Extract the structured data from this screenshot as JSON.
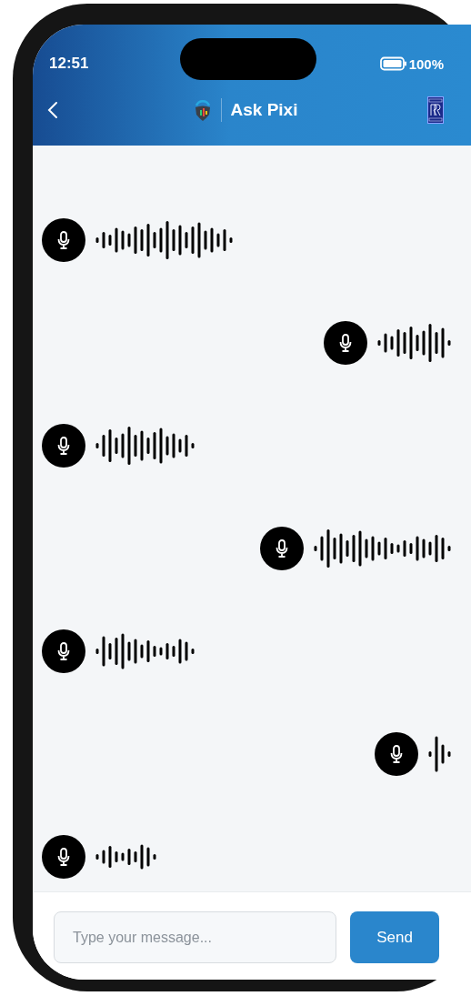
{
  "status_bar": {
    "time": "12:51",
    "battery": "100%"
  },
  "header": {
    "title": "Ask Pixi"
  },
  "messages": [
    {
      "kind": "incoming"
    },
    {
      "kind": "outgoing"
    },
    {
      "kind": "incoming"
    },
    {
      "kind": "outgoing"
    },
    {
      "kind": "incoming"
    },
    {
      "kind": "outgoing"
    },
    {
      "kind": "incoming"
    }
  ],
  "composer": {
    "placeholder": "Type your message...",
    "send": "Send"
  }
}
